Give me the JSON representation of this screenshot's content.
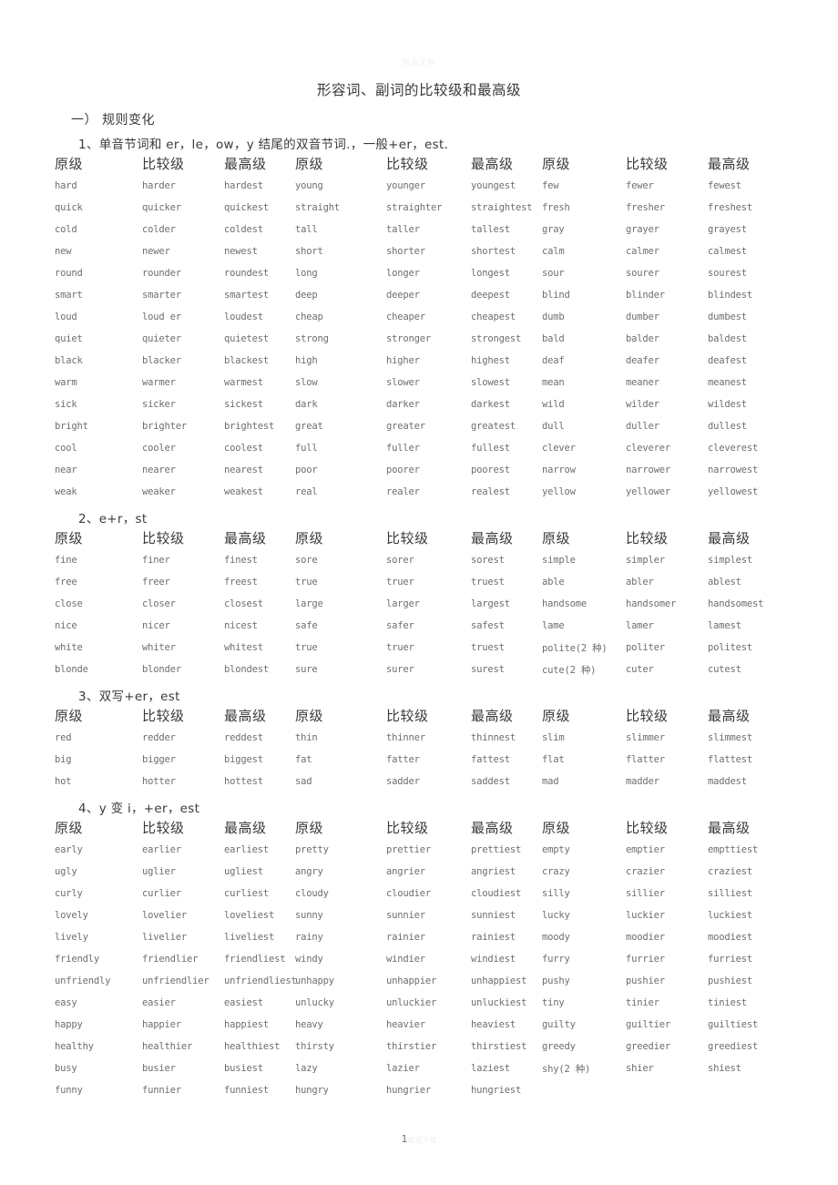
{
  "watermark": {
    "top": "精品文档",
    "bottom": "欢迎下载"
  },
  "document": {
    "title": "形容词、副词的比较级和最高级",
    "heading": "一） 规则变化",
    "page_number": "1"
  },
  "columns": [
    "原级",
    "比较级",
    "最高级",
    "原级",
    "比较级",
    "最高级",
    "原级",
    "比较级",
    "最高级"
  ],
  "sections": [
    {
      "id": "section-1",
      "heading": "1、单音节词和 er，le，ow，y 结尾的双音节词.，一般+er，est.",
      "rows": [
        [
          "hard",
          "harder",
          "hardest",
          "young",
          "younger",
          "youngest",
          "few",
          "fewer",
          "fewest"
        ],
        [
          "quick",
          "quicker",
          "quickest",
          "straight",
          "straighter",
          "straightest",
          "fresh",
          "fresher",
          "freshest"
        ],
        [
          "cold",
          "colder",
          "coldest",
          "tall",
          "taller",
          "tallest",
          "gray",
          "grayer",
          "grayest"
        ],
        [
          "new",
          "newer",
          "newest",
          "short",
          "shorter",
          "shortest",
          "calm",
          "calmer",
          "calmest"
        ],
        [
          "round",
          "rounder",
          "roundest",
          "long",
          "longer",
          "longest",
          "sour",
          "sourer",
          "sourest"
        ],
        [
          "smart",
          "smarter",
          "smartest",
          "deep",
          "deeper",
          "deepest",
          "blind",
          "blinder",
          "blindest"
        ],
        [
          "loud",
          "loud er",
          "loudest",
          "cheap",
          "cheaper",
          "cheapest",
          "dumb",
          "dumber",
          "dumbest"
        ],
        [
          "quiet",
          "quieter",
          "quietest",
          "strong",
          "stronger",
          "strongest",
          "bald",
          "balder",
          "baldest"
        ],
        [
          "black",
          "blacker",
          "blackest",
          "high",
          "higher",
          "highest",
          "deaf",
          "deafer",
          "deafest"
        ],
        [
          "warm",
          "warmer",
          "warmest",
          "slow",
          "slower",
          "slowest",
          "mean",
          "meaner",
          "meanest"
        ],
        [
          "sick",
          "sicker",
          "sickest",
          "dark",
          "darker",
          "darkest",
          "wild",
          "wilder",
          "wildest"
        ],
        [
          "bright",
          "brighter",
          "brightest",
          "great",
          "greater",
          "greatest",
          "dull",
          "duller",
          "dullest"
        ],
        [
          "cool",
          "cooler",
          "coolest",
          "full",
          "fuller",
          "fullest",
          "clever",
          "cleverer",
          "cleverest"
        ],
        [
          "near",
          "nearer",
          "nearest",
          "poor",
          "poorer",
          "poorest",
          "narrow",
          "narrower",
          "narrowest"
        ],
        [
          "weak",
          "weaker",
          "weakest",
          "real",
          "realer",
          "realest",
          "yellow",
          "yellower",
          "yellowest"
        ]
      ]
    },
    {
      "id": "section-2",
      "heading": "2、e+r，st",
      "rows": [
        [
          "fine",
          "finer",
          "finest",
          "sore",
          "sorer",
          "sorest",
          "simple",
          "simpler",
          "simplest"
        ],
        [
          "free",
          "freer",
          "freest",
          "true",
          "truer",
          "truest",
          "able",
          "abler",
          "ablest"
        ],
        [
          "close",
          "closer",
          "closest",
          "large",
          "larger",
          "largest",
          "handsome",
          "handsomer",
          "handsomest"
        ],
        [
          "nice",
          "nicer",
          "nicest",
          "safe",
          "safer",
          "safest",
          "lame",
          "lamer",
          "lamest"
        ],
        [
          "white",
          "whiter",
          "whitest",
          "true",
          "truer",
          "truest",
          "polite(2 种)",
          "politer",
          "politest"
        ],
        [
          "blonde",
          "blonder",
          "blondest",
          "sure",
          "surer",
          "surest",
          "cute(2 种)",
          "cuter",
          "cutest"
        ]
      ]
    },
    {
      "id": "section-3",
      "heading": "3、双写+er，est",
      "rows": [
        [
          "red",
          "redder",
          "reddest",
          "thin",
          "thinner",
          "thinnest",
          "slim",
          "slimmer",
          "slimmest"
        ],
        [
          "big",
          "bigger",
          "biggest",
          "fat",
          "fatter",
          "fattest",
          "flat",
          "flatter",
          "flattest"
        ],
        [
          "hot",
          "hotter",
          "hottest",
          "sad",
          "sadder",
          "saddest",
          "mad",
          "madder",
          "maddest"
        ]
      ]
    },
    {
      "id": "section-4",
      "heading": "4、y 变 i，+er，est",
      "rows": [
        [
          "early",
          "earlier",
          "earliest",
          "pretty",
          "prettier",
          "prettiest",
          "empty",
          "emptier",
          "empttiest"
        ],
        [
          "ugly",
          "uglier",
          "ugliest",
          "angry",
          "angrier",
          "angriest",
          "crazy",
          "crazier",
          "craziest"
        ],
        [
          "curly",
          "curlier",
          "curliest",
          "cloudy",
          "cloudier",
          "cloudiest",
          "silly",
          "sillier",
          "silliest"
        ],
        [
          "lovely",
          "lovelier",
          "loveliest",
          "sunny",
          "sunnier",
          "sunniest",
          "lucky",
          "luckier",
          "luckiest"
        ],
        [
          "lively",
          "livelier",
          "liveliest",
          "rainy",
          "rainier",
          "rainiest",
          "moody",
          "moodier",
          "moodiest"
        ],
        [
          "friendly",
          "friendlier",
          "friendliest",
          "windy",
          "windier",
          "windiest",
          "furry",
          "furrier",
          "furriest"
        ],
        [
          "unfriendly",
          "unfriendlier",
          "unfriendliest",
          "unhappy",
          "unhappier",
          "unhappiest",
          "pushy",
          "pushier",
          "pushiest"
        ],
        [
          "easy",
          "easier",
          "easiest",
          "unlucky",
          "unluckier",
          "unluckiest",
          "tiny",
          "tinier",
          "tiniest"
        ],
        [
          "happy",
          "happier",
          "happiest",
          "heavy",
          "heavier",
          "heaviest",
          "guilty",
          "guiltier",
          "guiltiest"
        ],
        [
          "healthy",
          "healthier",
          "healthiest",
          "thirsty",
          "thirstier",
          "thirstiest",
          "greedy",
          "greedier",
          "greediest"
        ],
        [
          "busy",
          "busier",
          "busiest",
          "lazy",
          "lazier",
          "laziest",
          "shy(2 种)",
          "shier",
          "shiest"
        ],
        [
          "funny",
          "funnier",
          "funniest",
          "hungry",
          "hungrier",
          "hungriest",
          "",
          "",
          ""
        ]
      ]
    }
  ]
}
